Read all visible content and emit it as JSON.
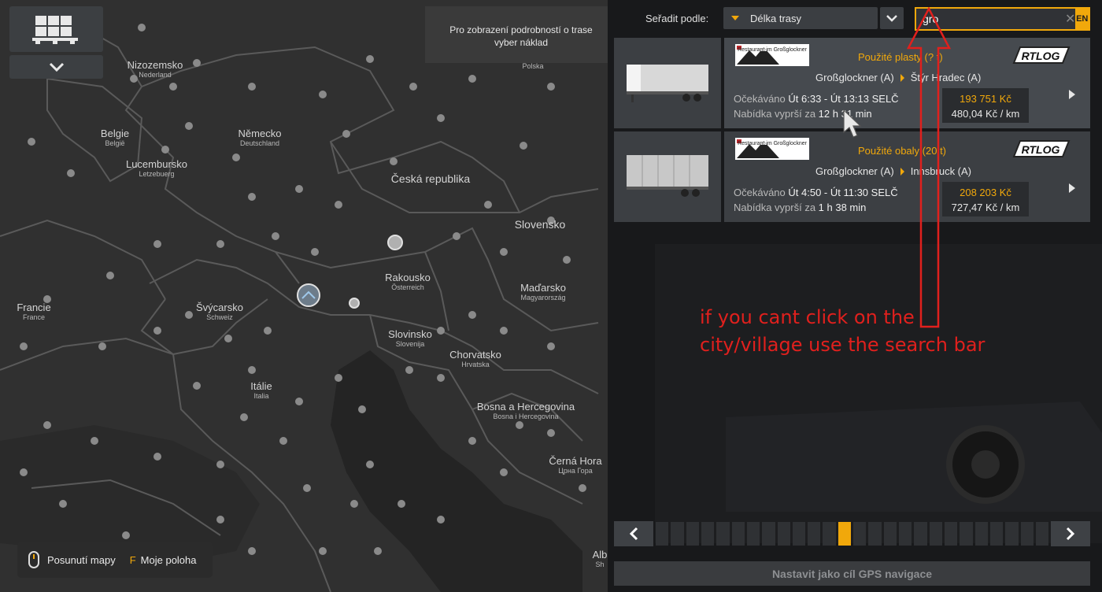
{
  "map": {
    "hint": "Pro zobrazení podrobností o trase vyber náklad",
    "labels": [
      {
        "name": "Nizozemsko",
        "sub": "Nederland"
      },
      {
        "name": "Belgie",
        "sub": "België"
      },
      {
        "name": "Lucembursko",
        "sub": "Letzebuerg"
      },
      {
        "name": "Německo",
        "sub": "Deutschland"
      },
      {
        "name": "Polska",
        "sub": ""
      },
      {
        "name": "Česká republika",
        "sub": ""
      },
      {
        "name": "Slovensko",
        "sub": ""
      },
      {
        "name": "Rakousko",
        "sub": "Österreich"
      },
      {
        "name": "Maďarsko",
        "sub": "Magyarország"
      },
      {
        "name": "Francie",
        "sub": "France"
      },
      {
        "name": "Švýcarsko",
        "sub": "Schweiz"
      },
      {
        "name": "Slovinsko",
        "sub": "Slovenija"
      },
      {
        "name": "Chorvatsko",
        "sub": "Hrvatska"
      },
      {
        "name": "Itálie",
        "sub": "Italia"
      },
      {
        "name": "Bosna a Hercegovina",
        "sub": "Bosna i Hercegovina"
      },
      {
        "name": "Černá Hora",
        "sub": "Црна Гора"
      },
      {
        "name": "Alb",
        "sub": "Sh"
      }
    ],
    "controls": {
      "mouse_label": "Posunutí mapy",
      "key": "F",
      "key_label": "Moje poloha"
    }
  },
  "panel": {
    "sort_label": "Seřadit podle:",
    "sort_value": "Délka trasy",
    "search_value": "gro",
    "lang": "EN",
    "jobs": [
      {
        "company": "Restaurant im Großglockner",
        "cargo": "Použité plasty (? t)",
        "from": "Großglockner (A)",
        "to": "Štýr Hradec (A)",
        "expected_label": "Očekáváno",
        "expected": "Út 6:33 - Út 13:13 SELČ",
        "expires_label": "Nabídka vyprší za",
        "expires": "12 h 31 min",
        "price": "193 751 Kč",
        "per_km": "480,04 Kč / km",
        "brand": "RTLOG"
      },
      {
        "company": "Restaurant im Großglockner",
        "cargo": "Použité obaly (20 t)",
        "from": "Großglockner (A)",
        "to": "Innsbruck (A)",
        "expected_label": "Očekáváno",
        "expected": "Út 4:50 - Út 11:30 SELČ",
        "expires_label": "Nabídka vyprší za",
        "expires": "1 h 38 min",
        "price": "208 203 Kč",
        "per_km": "727,47 Kč / km",
        "brand": "RTLOG"
      }
    ],
    "gps_button": "Nastavit jako cíl GPS navigace"
  },
  "annotation": {
    "line1": "if you cant click on the",
    "line2": "city/village use the search bar",
    "color": "#e0201d"
  },
  "colors": {
    "accent": "#f1a80b",
    "map_bg": "#303030",
    "panel_bg": "#18191b"
  }
}
